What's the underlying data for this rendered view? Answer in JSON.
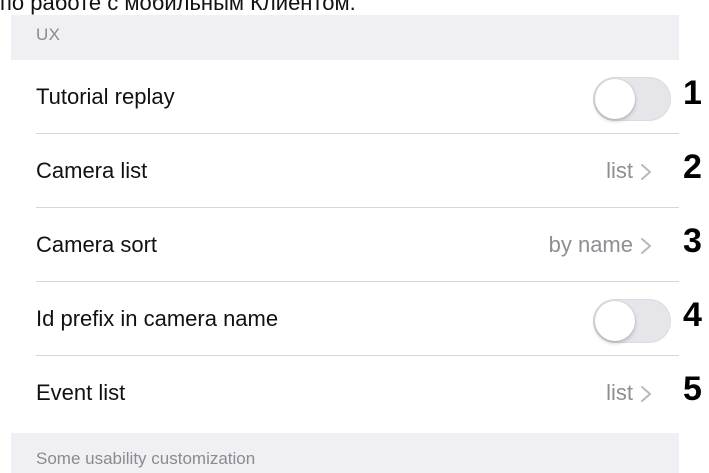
{
  "caption": "по работе с мобильным Клиентом.",
  "section": {
    "header": "UX",
    "footer": "Some usability customization"
  },
  "rows": [
    {
      "label": "Tutorial replay",
      "control": "switch",
      "on": false,
      "marker": "1"
    },
    {
      "label": "Camera list",
      "control": "disclosure",
      "value": "list",
      "marker": "2"
    },
    {
      "label": "Camera sort",
      "control": "disclosure",
      "value": "by name",
      "marker": "3"
    },
    {
      "label": "Id prefix in camera name",
      "control": "switch",
      "on": false,
      "marker": "4"
    },
    {
      "label": "Event list",
      "control": "disclosure",
      "value": "list",
      "marker": "5"
    }
  ],
  "icons": {
    "disclosure": "chevron-right-icon"
  },
  "colors": {
    "groupedBackground": "#efeff4",
    "secondaryText": "#8e8e93",
    "separator": "#d6d6da"
  }
}
